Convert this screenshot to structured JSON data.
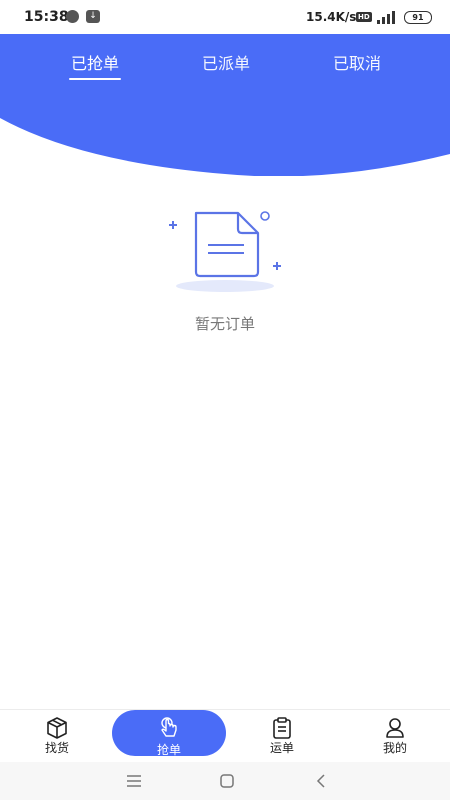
{
  "status_bar": {
    "time": "15:38",
    "network_speed": "15.4K/s",
    "hd_badge": "HD",
    "battery": "91"
  },
  "tabs": [
    {
      "label": "已抢单",
      "active": true
    },
    {
      "label": "已派单",
      "active": false
    },
    {
      "label": "已取消",
      "active": false
    }
  ],
  "empty_state": {
    "message": "暂无订单",
    "icon": "document-icon"
  },
  "bottom_nav": [
    {
      "label": "找货",
      "icon": "box-icon"
    },
    {
      "label": "抢单",
      "icon": "hand-tap-icon",
      "active": true
    },
    {
      "label": "运单",
      "icon": "clipboard-icon"
    },
    {
      "label": "我的",
      "icon": "user-icon"
    }
  ],
  "colors": {
    "primary": "#4a6cf7",
    "illustration_accent": "#5b74e6",
    "text_muted": "#777777"
  }
}
